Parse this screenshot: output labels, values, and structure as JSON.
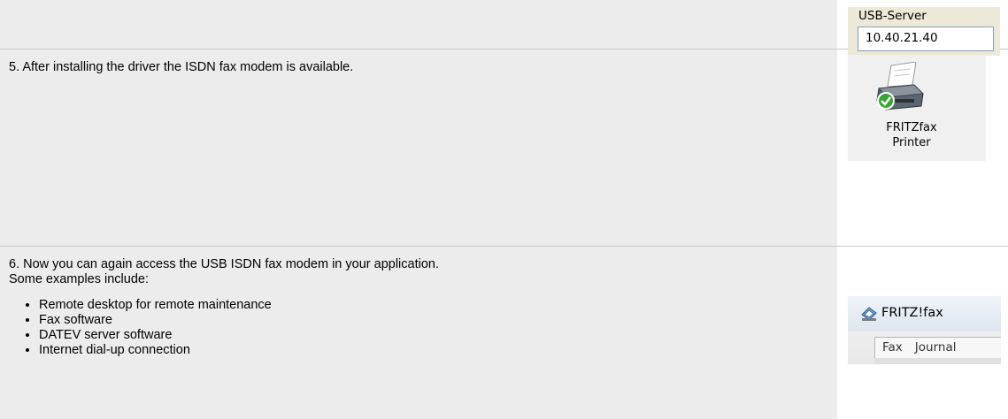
{
  "usb_server": {
    "label": "USB-Server",
    "value": "10.40.21.40"
  },
  "step5": {
    "text": "5. After installing the driver the ISDN fax modem is available.",
    "printer_label_line1": "FRITZfax",
    "printer_label_line2": "Printer"
  },
  "step6": {
    "text": "6. Now you can again access the USB ISDN fax modem in your application.",
    "subtext": "Some examples include:",
    "items": [
      "Remote desktop for remote maintenance",
      "Fax software",
      "DATEV server software",
      "Internet dial-up connection"
    ],
    "window_title": "FRITZ!fax",
    "menu": [
      "Fax",
      "Journal"
    ]
  }
}
